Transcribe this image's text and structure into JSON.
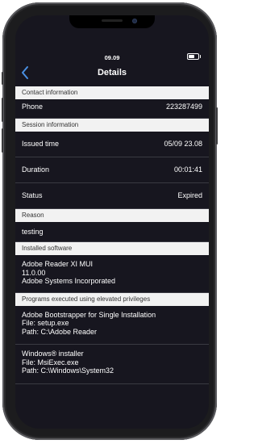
{
  "status_bar": {
    "time": "09.09"
  },
  "nav": {
    "title": "Details"
  },
  "sections": {
    "contact": {
      "header": "Contact information",
      "phone_label": "Phone",
      "phone_value": "223287499"
    },
    "session": {
      "header": "Session information",
      "issued_label": "Issued time",
      "issued_value": "05/09 23.08",
      "duration_label": "Duration",
      "duration_value": "00:01:41",
      "status_label": "Status",
      "status_value": "Expired"
    },
    "reason": {
      "header": "Reason",
      "value": "testing"
    },
    "software": {
      "header": "Installed software",
      "name": "Adobe Reader XI  MUI",
      "version": "11.0.00",
      "publisher": "Adobe Systems Incorporated"
    },
    "programs": {
      "header": "Programs executed using elevated privileges",
      "items": [
        {
          "name": "Adobe Bootstrapper for Single Installation",
          "file": "File: setup.exe",
          "path": "Path: C:\\Adobe Reader"
        },
        {
          "name": "Windows® installer",
          "file": "File: MsiExec.exe",
          "path": "Path: C:\\Windows\\System32"
        }
      ]
    }
  }
}
